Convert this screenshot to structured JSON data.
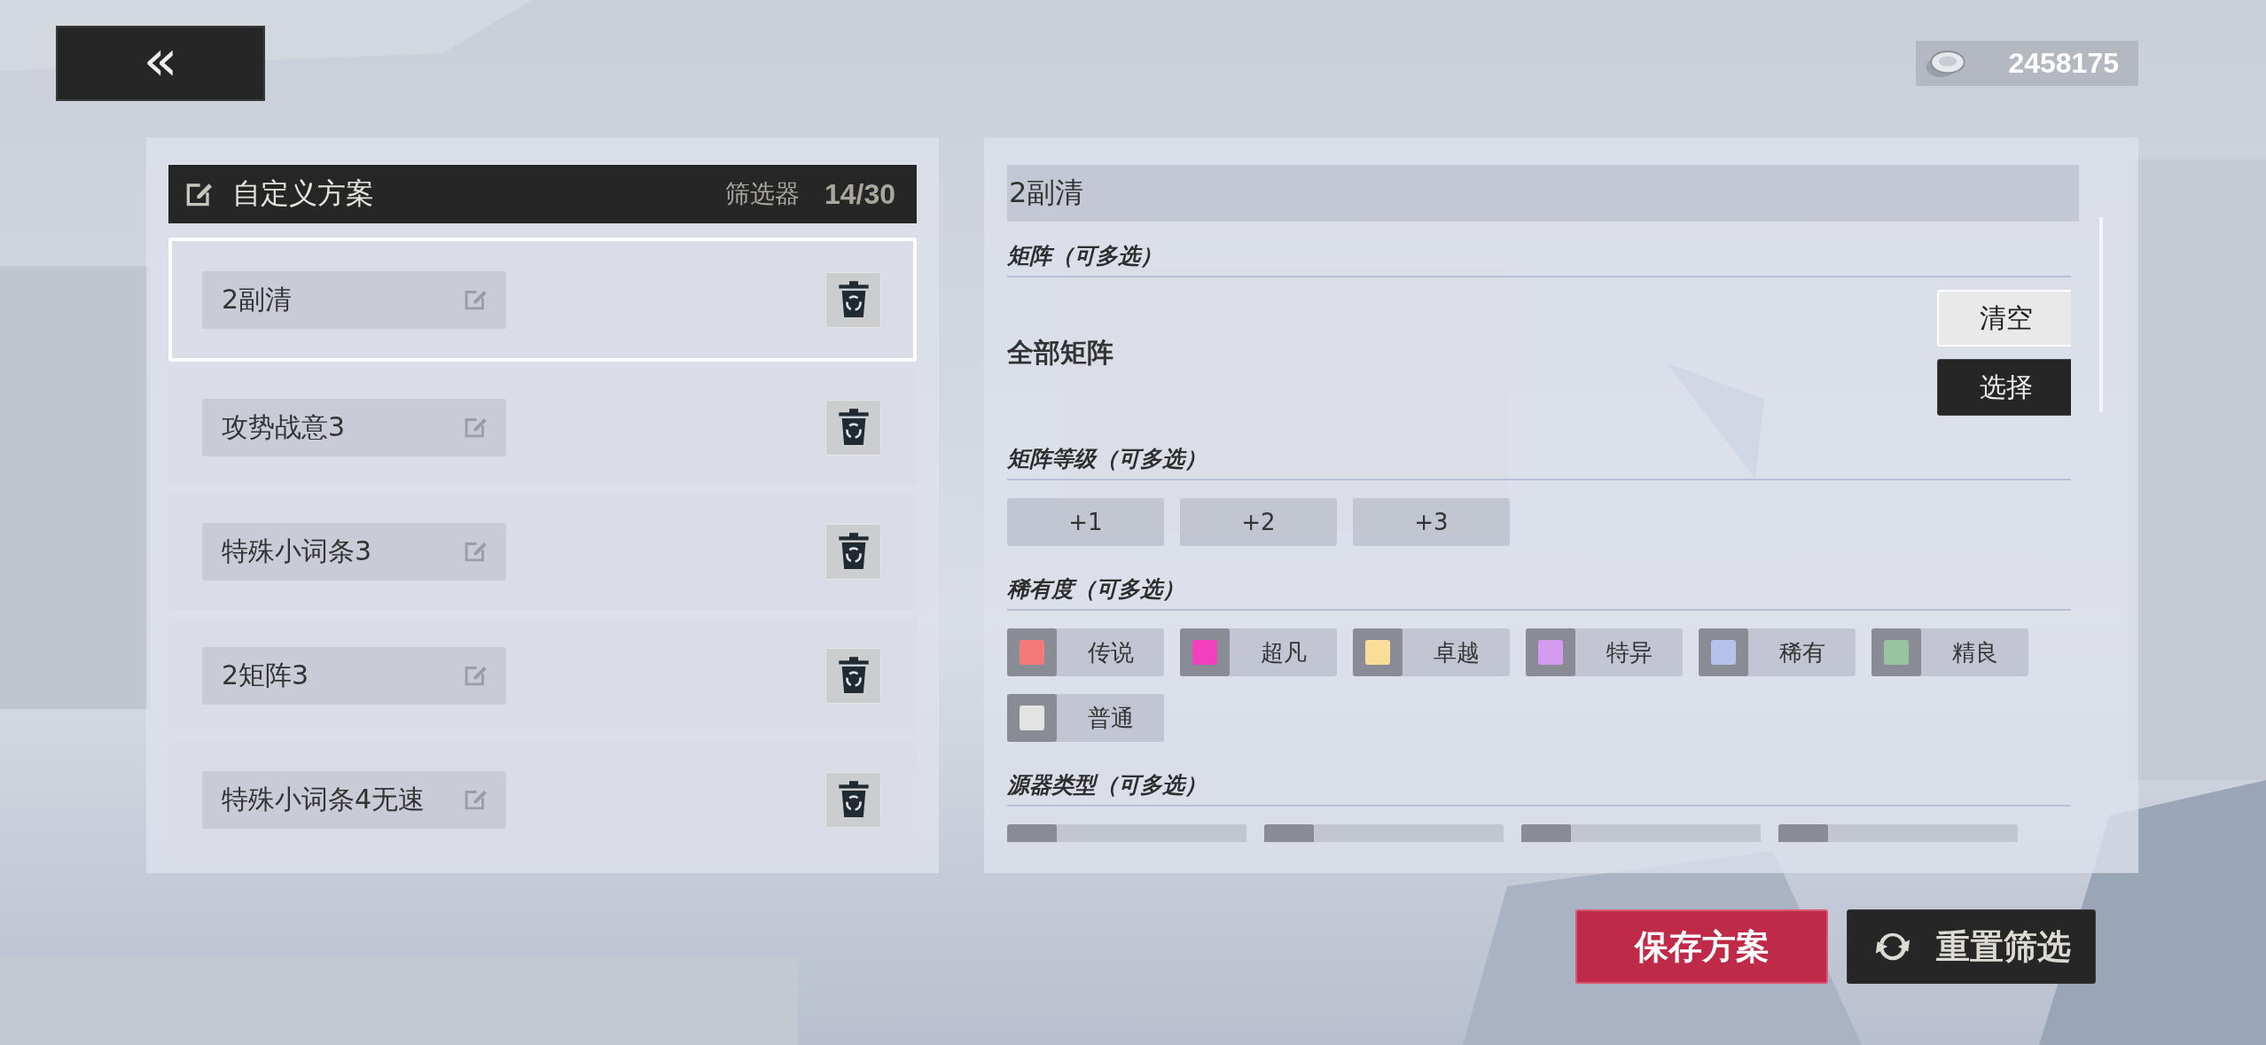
{
  "back_button": {
    "icon": "«"
  },
  "currency": {
    "amount": "2458175"
  },
  "schemes_panel": {
    "title": "自定义方案",
    "filter_label": "筛选器",
    "count": "14/30",
    "items": [
      {
        "name": "2副清",
        "selected": true
      },
      {
        "name": "攻势战意3",
        "selected": false
      },
      {
        "name": "特殊小词条3",
        "selected": false
      },
      {
        "name": "2矩阵3",
        "selected": false
      },
      {
        "name": "特殊小词条4无速",
        "selected": false
      }
    ]
  },
  "filter_panel": {
    "title": "2副清",
    "matrix": {
      "heading": "矩阵（可多选）",
      "value": "全部矩阵",
      "clear_button": "清空",
      "select_button": "选择"
    },
    "matrix_level": {
      "heading": "矩阵等级（可多选）",
      "options": [
        {
          "label": "+1",
          "selected": false
        },
        {
          "label": "+2",
          "selected": false
        },
        {
          "label": "+3",
          "selected": false
        }
      ]
    },
    "rarity": {
      "heading": "稀有度（可多选）",
      "options": [
        {
          "label": "传说",
          "color": "#f47a7a",
          "selected": false
        },
        {
          "label": "超凡",
          "color": "#f23fbd",
          "selected": false
        },
        {
          "label": "卓越",
          "color": "#fbdd9a",
          "selected": false
        },
        {
          "label": "特异",
          "color": "#d59bf0",
          "selected": false
        },
        {
          "label": "稀有",
          "color": "#b4c1e8",
          "selected": false
        },
        {
          "label": "精良",
          "color": "#9ac4a0",
          "selected": false
        },
        {
          "label": "普通",
          "color": "#e3e3e3",
          "selected": false
        }
      ]
    },
    "source_type": {
      "heading": "源器类型（可多选）",
      "options": [
        {
          "kind": "cut"
        },
        {
          "kind": "cut"
        },
        {
          "kind": "cut"
        },
        {
          "kind": "cut"
        }
      ]
    }
  },
  "actions": {
    "save": "保存方案",
    "reset": "重置筛选"
  }
}
